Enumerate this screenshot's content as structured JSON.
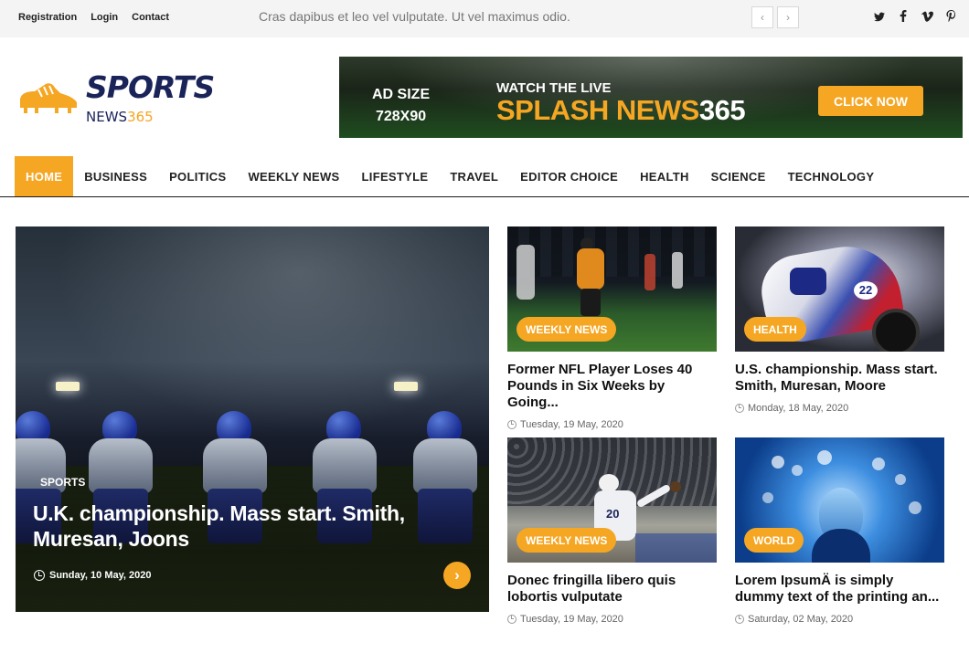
{
  "topbar": {
    "links": [
      "Registration",
      "Login",
      "Contact"
    ],
    "ticker_text": "Cras dapibus et leo vel vulputate. Ut vel maximus odio.",
    "ticker_prev": "‹",
    "ticker_next": "›",
    "social": [
      "𝕥",
      "f",
      "v",
      "p"
    ]
  },
  "logo": {
    "brand": "SPORTS",
    "sub_dark": "NEWS",
    "sub_accent": "365"
  },
  "banner": {
    "ad_size_line1": "AD SIZE",
    "ad_size_line2": "728X90",
    "watch": "WATCH THE LIVE",
    "splash_accent": "SPLASH NEWS",
    "splash_white": "365",
    "cta": "CLICK NOW"
  },
  "nav": {
    "items": [
      "HOME",
      "BUSINESS",
      "POLITICS",
      "WEEKLY NEWS",
      "LIFESTYLE",
      "TRAVEL",
      "EDITOR CHOICE",
      "HEALTH",
      "SCIENCE",
      "TECHNOLOGY"
    ],
    "active_index": 0
  },
  "hero": {
    "category": "SPORTS",
    "title": "U.K. championship. Mass start. Smith, Muresan, Joons",
    "date": "Sunday, 10 May, 2020",
    "next_glyph": "›"
  },
  "cards": [
    {
      "category": "WEEKLY NEWS",
      "title": "Former NFL Player Loses 40 Pounds in Six Weeks by Going...",
      "date": "Tuesday, 19 May, 2020"
    },
    {
      "category": "HEALTH",
      "title": "U.S. championship. Mass start. Smith, Muresan, Moore",
      "date": "Monday, 18 May, 2020"
    },
    {
      "category": "WEEKLY NEWS",
      "title": "Donec fringilla libero quis lobortis vulputate",
      "date": "Tuesday, 19 May, 2020"
    },
    {
      "category": "WORLD",
      "title": "Lorem IpsumÄ is simply dummy text of the printing an...",
      "date": "Saturday, 02 May, 2020"
    }
  ],
  "colors": {
    "accent": "#f5a623",
    "brand": "#1b2459",
    "topbar_bg": "#f4f4f4"
  }
}
